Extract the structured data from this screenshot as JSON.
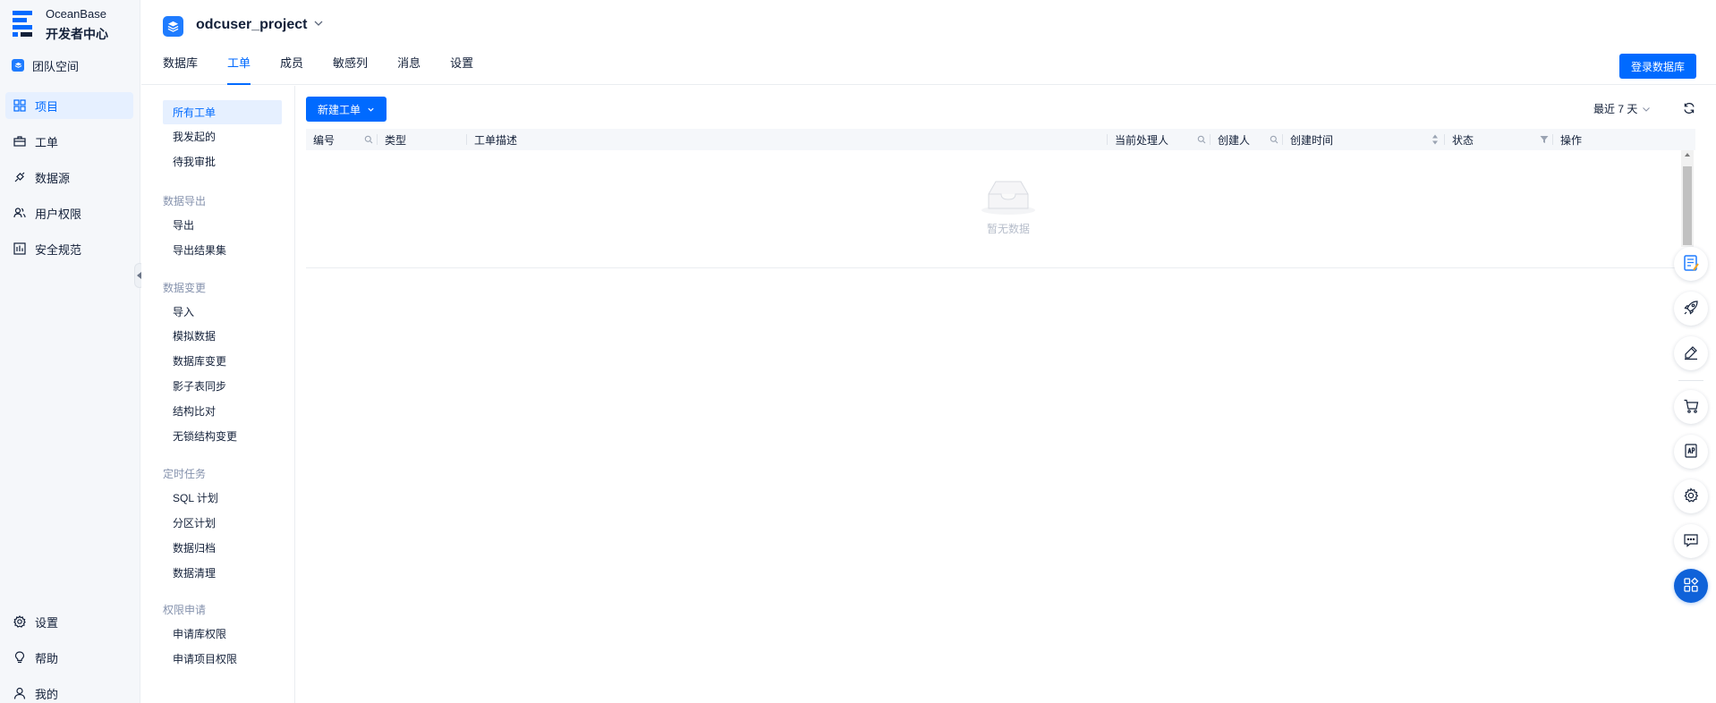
{
  "app": {
    "brand_line1": "OceanBase",
    "brand_line2": "开发者中心"
  },
  "nav": {
    "team_space": "团队空间",
    "items": [
      {
        "label": "项目",
        "icon": "grid-icon",
        "active": true
      },
      {
        "label": "工单",
        "icon": "briefcase-icon",
        "active": false
      },
      {
        "label": "数据源",
        "icon": "plug-icon",
        "active": false
      },
      {
        "label": "用户权限",
        "icon": "users-icon",
        "active": false
      },
      {
        "label": "安全规范",
        "icon": "shield-rules-icon",
        "active": false
      }
    ],
    "bottom": [
      {
        "label": "设置",
        "icon": "gear-icon"
      },
      {
        "label": "帮助",
        "icon": "bulb-icon"
      },
      {
        "label": "我的",
        "icon": "user-icon"
      }
    ]
  },
  "header": {
    "project_name": "odcuser_project",
    "tabs": [
      {
        "label": "数据库",
        "active": false
      },
      {
        "label": "工单",
        "active": true
      },
      {
        "label": "成员",
        "active": false
      },
      {
        "label": "敏感列",
        "active": false
      },
      {
        "label": "消息",
        "active": false
      },
      {
        "label": "设置",
        "active": false
      }
    ],
    "login_db_label": "登录数据库"
  },
  "subnav": {
    "top": [
      "所有工单",
      "我发起的",
      "待我审批"
    ],
    "groups": [
      {
        "title": "数据导出",
        "items": [
          "导出",
          "导出结果集"
        ]
      },
      {
        "title": "数据变更",
        "items": [
          "导入",
          "模拟数据",
          "数据库变更",
          "影子表同步",
          "结构比对",
          "无锁结构变更"
        ]
      },
      {
        "title": "定时任务",
        "items": [
          "SQL 计划",
          "分区计划",
          "数据归档",
          "数据清理"
        ]
      },
      {
        "title": "权限申请",
        "items": [
          "申请库权限",
          "申请项目权限"
        ]
      }
    ]
  },
  "toolbar": {
    "new_ticket_label": "新建工单",
    "time_range": "最近 7 天"
  },
  "table": {
    "columns": [
      "编号",
      "类型",
      "工单描述",
      "当前处理人",
      "创建人",
      "创建时间",
      "状态",
      "操作"
    ],
    "empty_text": "暂无数据"
  },
  "floating_tools": [
    "notes-icon",
    "rocket-icon",
    "edit-icon",
    "cart-icon",
    "api-icon",
    "gear-icon",
    "chat-icon",
    "apps-icon"
  ],
  "colors": {
    "primary": "#006aff",
    "fab_primary": "#0f62d9",
    "nav_bg": "#f5f7fa"
  }
}
